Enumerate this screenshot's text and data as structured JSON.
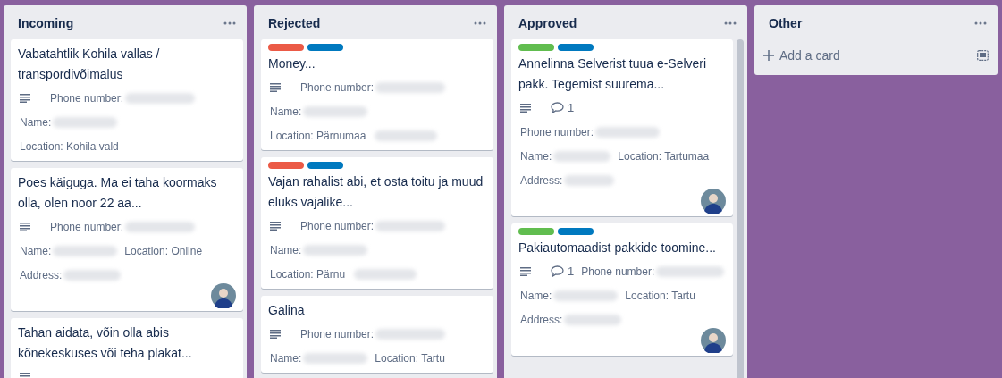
{
  "lists": [
    {
      "title": "Incoming",
      "scroll": false,
      "cards": [
        {
          "title": "Vabatahtlik Kohila vallas / transpordivõimalus",
          "avatar": false,
          "rows": [
            [
              {
                "kind": "description"
              },
              {
                "kind": "field",
                "label": "Phone number:",
                "redacted": true
              }
            ],
            [
              {
                "kind": "field",
                "label": "Name:",
                "redacted": true
              }
            ],
            [
              {
                "kind": "field",
                "label": "Location: Kohila vald",
                "redacted": false
              }
            ]
          ]
        },
        {
          "title": "Poes käiguga. Ma ei taha koormaks olla, olen noor 22 aa...",
          "avatar": true,
          "rows": [
            [
              {
                "kind": "description"
              },
              {
                "kind": "field",
                "label": "Phone number:",
                "redacted": true
              }
            ],
            [
              {
                "kind": "field",
                "label": "Name:",
                "redacted": true
              },
              {
                "kind": "field",
                "label": "Location: Online",
                "redacted": false
              }
            ],
            [
              {
                "kind": "field",
                "label": "Address:",
                "redacted": true
              }
            ]
          ]
        },
        {
          "title": "Tahan aidata, võin olla abis kõnekeskuses või teha plakat...",
          "avatar": false,
          "rows": [
            [
              {
                "kind": "description"
              }
            ]
          ]
        }
      ]
    },
    {
      "title": "Rejected",
      "scroll": false,
      "cards": [
        {
          "labels": [
            {
              "color": "#eb5a46"
            },
            {
              "color": "#0079bf"
            }
          ],
          "title": "Money...",
          "avatar": false,
          "rows": [
            [
              {
                "kind": "description"
              },
              {
                "kind": "field",
                "label": "Phone number:",
                "redacted": true
              }
            ],
            [
              {
                "kind": "field",
                "label": "Name:",
                "redacted": true
              }
            ],
            [
              {
                "kind": "field",
                "label": "Location: Pärnumaa",
                "redacted": false
              },
              {
                "kind": "field",
                "redacted": true
              }
            ]
          ]
        },
        {
          "labels": [
            {
              "color": "#eb5a46"
            },
            {
              "color": "#0079bf"
            }
          ],
          "title": "Vajan rahalist abi, et osta toitu ja muud eluks vajalike...",
          "avatar": false,
          "rows": [
            [
              {
                "kind": "description"
              },
              {
                "kind": "field",
                "label": "Phone number:",
                "redacted": true
              }
            ],
            [
              {
                "kind": "field",
                "label": "Name:",
                "redacted": true
              }
            ],
            [
              {
                "kind": "field",
                "label": "Location: Pärnu",
                "redacted": false
              },
              {
                "kind": "field",
                "redacted": true
              }
            ]
          ]
        },
        {
          "title": "Galina",
          "avatar": false,
          "rows": [
            [
              {
                "kind": "description"
              },
              {
                "kind": "field",
                "label": "Phone number:",
                "redacted": true
              }
            ],
            [
              {
                "kind": "field",
                "label": "Name:",
                "redacted": true
              },
              {
                "kind": "field",
                "label": "Location: Tartu",
                "redacted": false
              }
            ]
          ]
        }
      ]
    },
    {
      "title": "Approved",
      "scroll": true,
      "cards": [
        {
          "labels": [
            {
              "color": "#61bd4f"
            },
            {
              "color": "#0079bf"
            }
          ],
          "title": "Annelinna Selverist tuua e-Selveri pakk. Tegemist suurema...",
          "avatar": true,
          "rows": [
            [
              {
                "kind": "description"
              },
              {
                "kind": "comments",
                "count": "1"
              }
            ],
            [
              {
                "kind": "field",
                "label": "Phone number:",
                "redacted": true
              }
            ],
            [
              {
                "kind": "field",
                "label": "Name:",
                "redacted": true
              },
              {
                "kind": "field",
                "label": "Location: Tartumaa",
                "redacted": false
              }
            ],
            [
              {
                "kind": "field",
                "label": "Address:",
                "redacted": true
              }
            ]
          ]
        },
        {
          "labels": [
            {
              "color": "#61bd4f"
            },
            {
              "color": "#0079bf"
            }
          ],
          "title": "Pakiautomaadist pakkide toomine...",
          "avatar": true,
          "rows": [
            [
              {
                "kind": "description"
              },
              {
                "kind": "comments",
                "count": "1"
              },
              {
                "kind": "field",
                "label": "Phone number:",
                "redacted": true
              }
            ],
            [
              {
                "kind": "field",
                "label": "Name:",
                "redacted": true
              },
              {
                "kind": "field",
                "label": "Location: Tartu",
                "redacted": false
              }
            ],
            [
              {
                "kind": "field",
                "label": "Address:",
                "redacted": true
              }
            ]
          ]
        }
      ]
    },
    {
      "title": "Other",
      "scroll": false,
      "add": "Add a card"
    }
  ]
}
